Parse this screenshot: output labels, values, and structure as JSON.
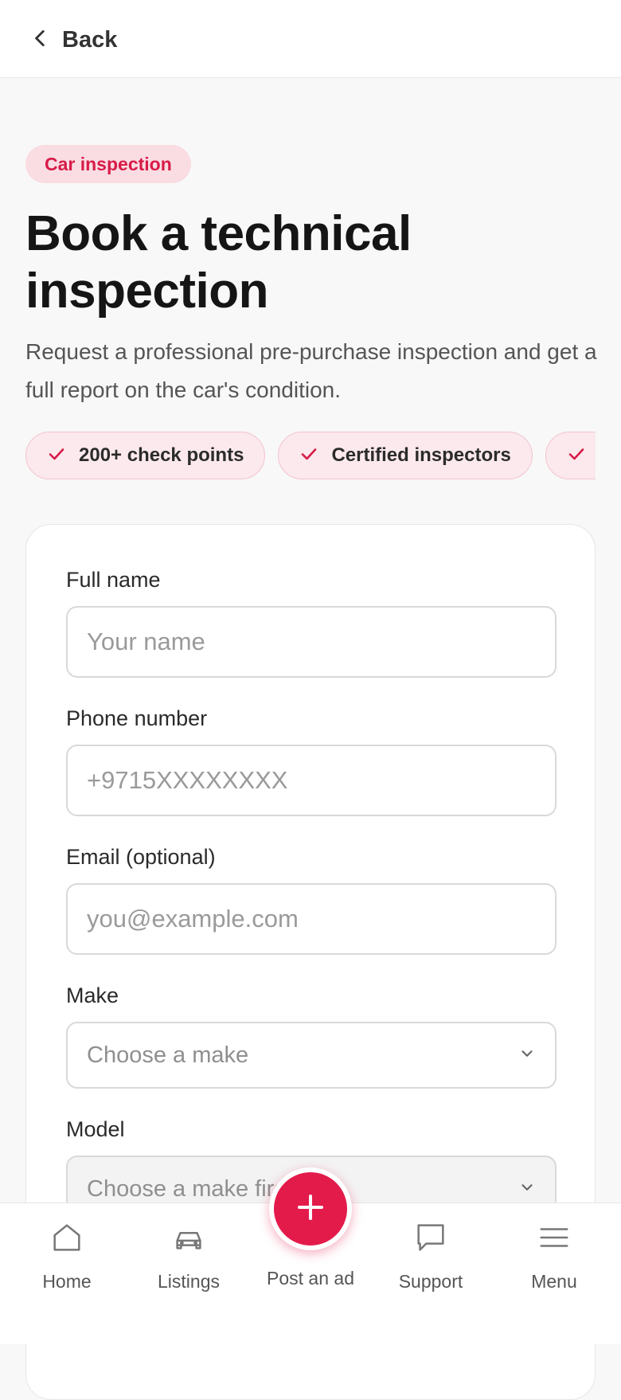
{
  "header": {
    "back_label": "Back"
  },
  "hero": {
    "tag": "Car inspection",
    "title": "Book a technical inspection",
    "subtitle": "Request a professional pre-purchase inspection and get a full report on the car's condition."
  },
  "chips": [
    {
      "label": "200+ check points",
      "icon": "check-icon"
    },
    {
      "label": "Certified inspectors",
      "icon": "check-icon"
    },
    {
      "label": "",
      "icon": "check-icon"
    }
  ],
  "form": {
    "full_name": {
      "label": "Full name",
      "placeholder": "Your name",
      "value": ""
    },
    "phone": {
      "label": "Phone number",
      "placeholder": "+9715XXXXXXXX",
      "value": ""
    },
    "email": {
      "label": "Email (optional)",
      "placeholder": "you@example.com",
      "value": ""
    },
    "make": {
      "label": "Make",
      "selected": "Choose a make"
    },
    "model": {
      "label": "Model",
      "selected": "Choose a make first"
    }
  },
  "bottom_nav": {
    "items": [
      {
        "label": "Home",
        "icon": "home-icon"
      },
      {
        "label": "Listings",
        "icon": "car-icon"
      },
      {
        "label": "Post an ad",
        "icon": "plus-icon"
      },
      {
        "label": "Support",
        "icon": "chat-icon"
      },
      {
        "label": "Menu",
        "icon": "menu-icon"
      }
    ]
  },
  "colors": {
    "accent": "#e31b4b",
    "tag_bg": "#f9dde3",
    "chip_bg": "#fbe9ed",
    "text": "#151515",
    "muted": "#555555"
  }
}
